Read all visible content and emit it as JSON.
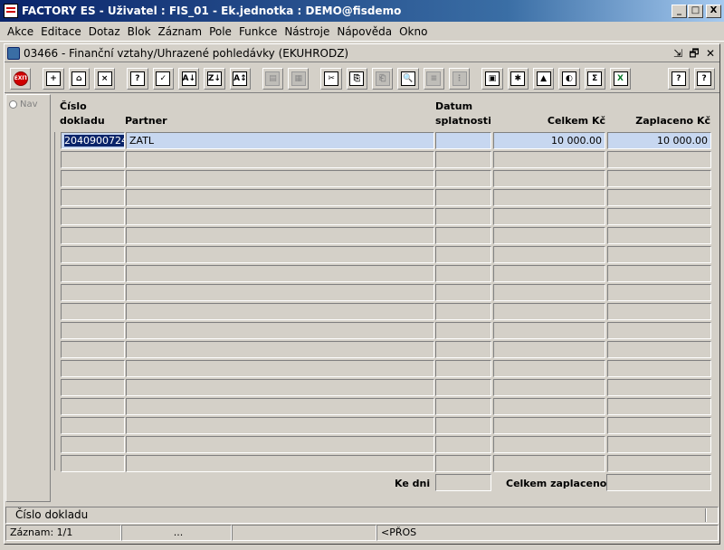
{
  "window": {
    "title": "FACTORY ES - Uživatel : FIS_01 - Ek.jednotka : DEMO@fisdemo",
    "min": "_",
    "max": "□",
    "close": "X"
  },
  "menu": [
    "Akce",
    "Editace",
    "Dotaz",
    "Blok",
    "Záznam",
    "Pole",
    "Funkce",
    "Nástroje",
    "Nápověda",
    "Okno"
  ],
  "form": {
    "title": "03466 - Finanční vztahy/Uhrazené pohledávky (EKUHRODZ)",
    "controls": [
      "⇲",
      "🗗",
      "✕"
    ]
  },
  "toolbar": {
    "exit": "EXIT",
    "buttons": [
      "+",
      "⌂",
      "×",
      "?",
      "✓",
      "A↓",
      "Z↓",
      "A↕",
      "▤",
      "▦",
      "✂",
      "⎘",
      "⎗",
      "🔍",
      "≡",
      "⋮",
      "▣",
      "✱",
      "▲",
      "◐",
      "Σ",
      "X",
      "?",
      "?"
    ]
  },
  "nav": {
    "label": "Nav"
  },
  "columns": {
    "cislo_line1": "Číslo",
    "cislo_line2": "dokladu",
    "partner": "Partner",
    "datum_line1": "Datum",
    "datum_line2": "splatnosti",
    "celkem": "Celkem Kč",
    "zaplaceno": "Zaplaceno Kč"
  },
  "rows": [
    {
      "cislo": "2040900724",
      "partner": "ZATL",
      "datum": "",
      "celkem": "10 000.00",
      "zaplaceno": "10 000.00"
    }
  ],
  "empty_row_count": 17,
  "footer": {
    "ke_dni": "Ke dni",
    "celkem_zaplaceno": "Celkem zaplaceno"
  },
  "status": {
    "message": "Číslo dokladu",
    "record": "Záznam: 1/1",
    "dots": "...",
    "mode": "<PŘOS"
  }
}
